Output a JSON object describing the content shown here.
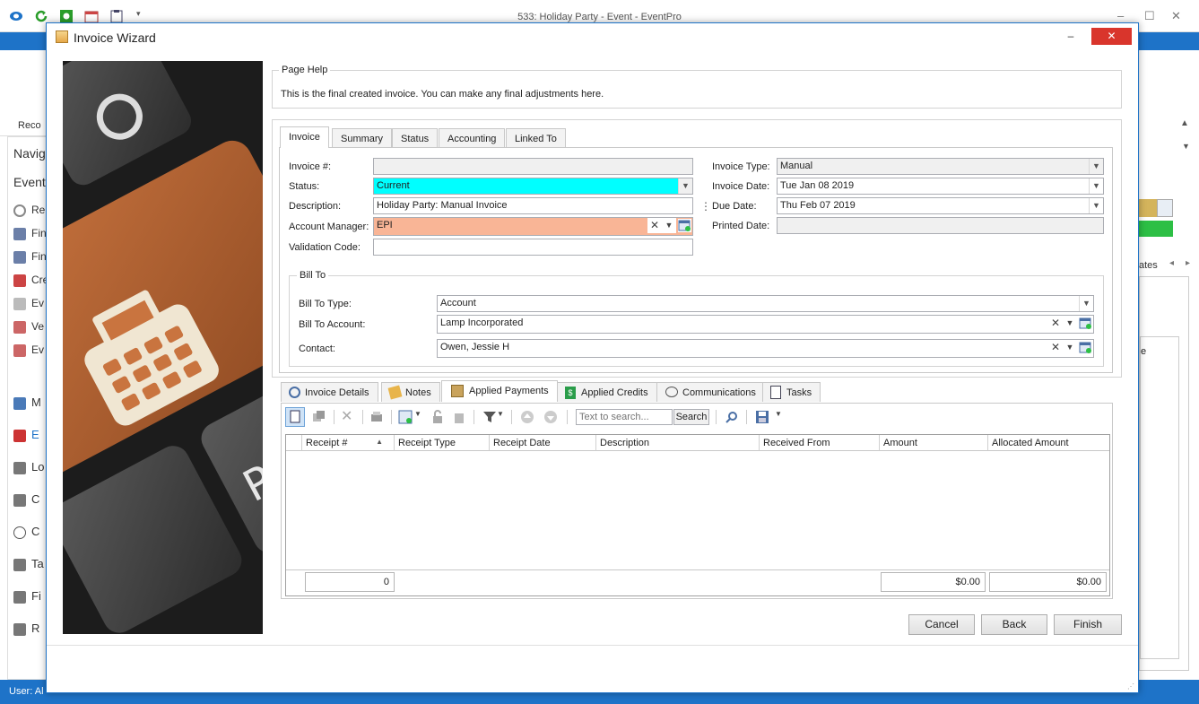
{
  "app": {
    "title": "533: Holiday Party - Event - EventPro",
    "status_text": "User: Al",
    "win_min": "–",
    "win_max": "☐",
    "win_close": "✕",
    "left_labels": [
      "Reco",
      "Navig",
      "Event",
      "Re",
      "Fin",
      "Fin",
      "Cre",
      "Ev",
      "Ve",
      "Ev",
      "M",
      "E",
      "Lo",
      "C",
      "C",
      "Ta",
      "Fi",
      "R"
    ],
    "right_text": "ates",
    "right_text2": "e"
  },
  "dialog": {
    "title": "Invoice Wizard",
    "min": "–",
    "max": "☐",
    "close": "✕"
  },
  "page_help": {
    "label": "Page Help",
    "text": "This is the final created invoice.  You can make any final adjustments here."
  },
  "top_tabs": [
    "Invoice",
    "Summary",
    "Status",
    "Accounting",
    "Linked To"
  ],
  "invoice": {
    "invoice_num_label": "Invoice #:",
    "invoice_num_value": "",
    "status_label": "Status:",
    "status_value": "Current",
    "description_label": "Description:",
    "description_value": "Holiday Party: Manual Invoice",
    "account_manager_label": "Account Manager:",
    "account_manager_value": "EPI",
    "validation_label": "Validation Code:",
    "validation_value": "",
    "invoice_type_label": "Invoice Type:",
    "invoice_type_value": "Manual",
    "invoice_date_label": "Invoice Date:",
    "invoice_date_value": "Tue Jan 08 2019",
    "due_date_label": "Due Date:",
    "due_date_value": "Thu Feb 07 2019",
    "printed_date_label": "Printed Date:",
    "printed_date_value": ""
  },
  "bill_to": {
    "label": "Bill To",
    "type_label": "Bill To Type:",
    "type_value": "Account",
    "account_label": "Bill To Account:",
    "account_value": "Lamp Incorporated",
    "contact_label": "Contact:",
    "contact_value": "Owen, Jessie H"
  },
  "bottom_tabs": [
    "Invoice Details",
    "Notes",
    "Applied Payments",
    "Applied Credits",
    "Communications",
    "Tasks"
  ],
  "toolbar": {
    "search_placeholder": "Text to search...",
    "search_button": "Search"
  },
  "grid": {
    "columns": [
      "Receipt #",
      "Receipt Type",
      "Receipt Date",
      "Description",
      "Received From",
      "Amount",
      "Allocated Amount"
    ],
    "rows": [],
    "count": "0",
    "amount_total": "$0.00",
    "allocated_total": "$0.00"
  },
  "buttons": {
    "cancel": "Cancel",
    "back": "Back",
    "finish": "Finish"
  },
  "colors": {
    "status_field": "#00ffff",
    "account_manager_field": "#f9b596",
    "accent": "#1e73c8",
    "close_button": "#d9352c"
  }
}
